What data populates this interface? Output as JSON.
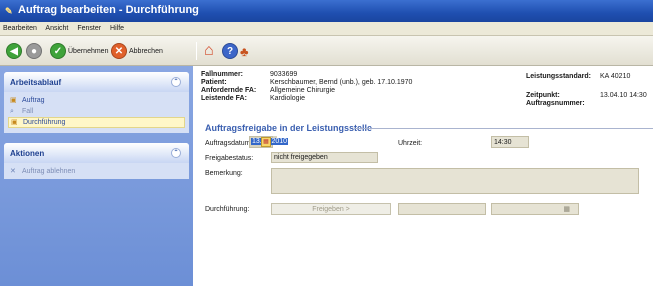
{
  "window": {
    "title": "Auftrag bearbeiten - Durchführung"
  },
  "menu": [
    "Bearbeiten",
    "Ansicht",
    "Fenster",
    "Hilfe"
  ],
  "toolbar": {
    "apply_label": "Übernehmen",
    "cancel_label": "Abbrechen"
  },
  "sidebar": {
    "workflow": {
      "title": "Arbeitsablauf",
      "items": [
        {
          "label": "Auftrag"
        },
        {
          "label": "Fall"
        },
        {
          "label": "Durchführung"
        }
      ]
    },
    "actions": {
      "title": "Aktionen",
      "items": [
        {
          "label": "Auftrag ablehnen"
        }
      ]
    }
  },
  "patient_info": {
    "case_number_label": "Fallnummer:",
    "case_number": "9033699",
    "patient_label": "Patient:",
    "patient": "Kerschbaumer, Bernd (unb.), geb. 17.10.1970",
    "requesting_label": "Anfordernde FA:",
    "requesting": "Allgemeine Chirurgie",
    "performing_label": "Leistende FA:",
    "performing": "Kardiologie",
    "standard_label": "Leistungsstandard:",
    "standard": "KA 40210",
    "time_label": "Zeitpunkt:",
    "time": "13.04.10 14:30",
    "order_no_label": "Auftragsnummer:"
  },
  "release": {
    "title": "Auftragsfreigabe in der Leistungsstelle",
    "date_label": "Auftragsdatum:",
    "date_value": "13.04.2010",
    "time_label": "Uhrzeit:",
    "time_value": "14:30",
    "status_label": "Freigabestatus:",
    "status_value": "nicht freigegeben",
    "remark_label": "Bemerkung:",
    "execution_label": "Durchführung:",
    "release_button": "Freigeben >"
  },
  "colors": {
    "titlebar": "#1f4fb0",
    "sidebar": "#7b9be0",
    "section_title": "#3a5fb0"
  }
}
